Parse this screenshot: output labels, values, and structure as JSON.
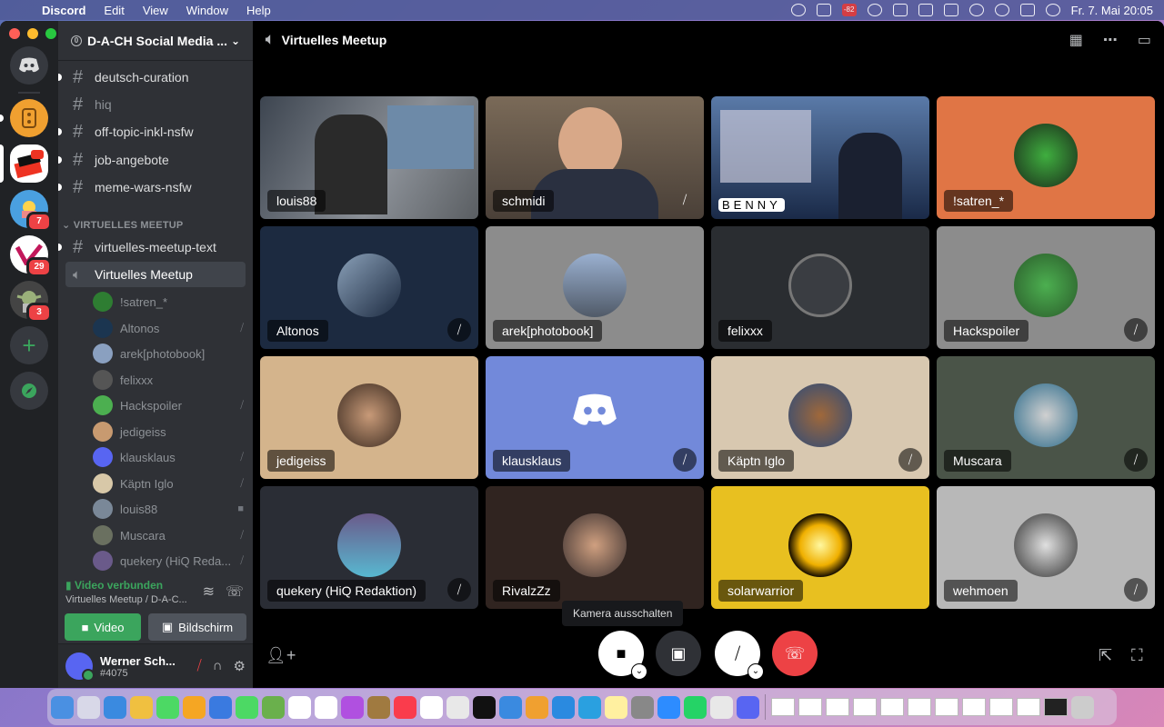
{
  "menubar": {
    "app_name": "Discord",
    "menus": [
      "Edit",
      "View",
      "Window",
      "Help"
    ],
    "datetime": "Fr. 7. Mai  20:05",
    "badge": "-82"
  },
  "servers": {
    "badges": [
      "7",
      "29",
      "3"
    ]
  },
  "sidebar": {
    "guild_name": "D-A-CH Social Media ...",
    "channels": [
      {
        "label": "deutsch-curation"
      },
      {
        "label": "hiq"
      },
      {
        "label": "off-topic-inkl-nsfw"
      },
      {
        "label": "job-angebote"
      },
      {
        "label": "meme-wars-nsfw"
      }
    ],
    "category": "VIRTUELLES MEETUP",
    "text_channel": "virtuelles-meetup-text",
    "voice_channel": "Virtuelles Meetup",
    "voice_users": [
      {
        "name": "!satren_*"
      },
      {
        "name": "Altonos"
      },
      {
        "name": "arek[photobook]"
      },
      {
        "name": "felixxx"
      },
      {
        "name": "Hackspoiler"
      },
      {
        "name": "jedigeiss"
      },
      {
        "name": "klausklaus"
      },
      {
        "name": "Käptn Iglo"
      },
      {
        "name": "louis88"
      },
      {
        "name": "Muscara"
      },
      {
        "name": "quekery (HiQ Reda..."
      }
    ],
    "rtc_status": "Video verbunden",
    "rtc_channel": "Virtuelles Meetup / D-A-C...",
    "video_button": "Video",
    "screen_button": "Bildschirm",
    "user_name": "Werner Sch...",
    "user_tag": "#4075"
  },
  "main": {
    "title": "Virtuelles Meetup",
    "tooltip": "Kamera ausschalten",
    "tiles": [
      {
        "name": "louis88"
      },
      {
        "name": "schmidi"
      },
      {
        "name": "BENNY"
      },
      {
        "name": "!satren_*"
      },
      {
        "name": "Altonos"
      },
      {
        "name": "arek[photobook]"
      },
      {
        "name": "felixxx"
      },
      {
        "name": "Hackspoiler"
      },
      {
        "name": "jedigeiss"
      },
      {
        "name": "klausklaus"
      },
      {
        "name": "Käptn Iglo"
      },
      {
        "name": "Muscara"
      },
      {
        "name": "quekery (HiQ Redaktion)"
      },
      {
        "name": "RivalzZz"
      },
      {
        "name": "solarwarrior"
      },
      {
        "name": "wehmoen"
      }
    ]
  },
  "colors": {
    "accent": "#5865f2",
    "online": "#3ba55d",
    "danger": "#ed4245"
  }
}
